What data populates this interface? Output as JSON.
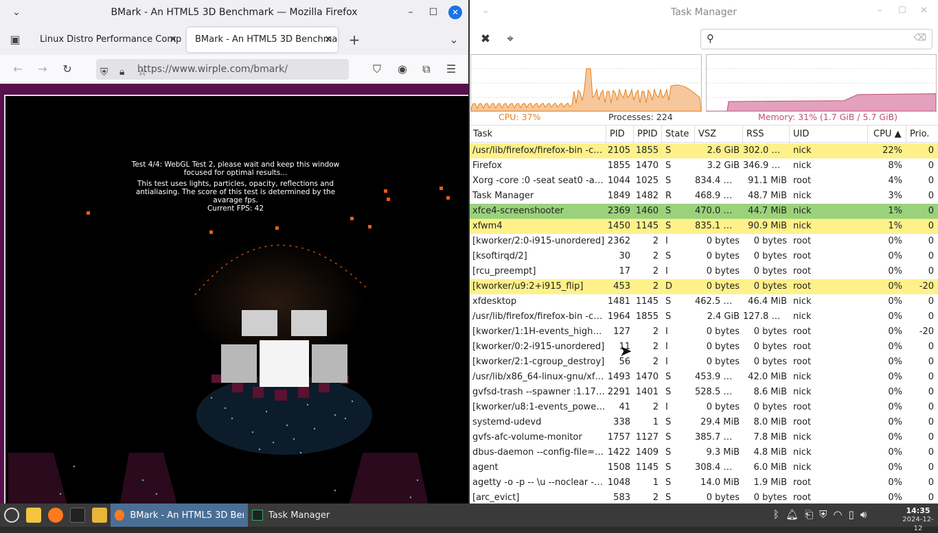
{
  "firefox": {
    "title": "BMark - An HTML5 3D Benchmark — Mozilla Firefox",
    "tabs": [
      {
        "label": "Linux Distro Performance Comp"
      },
      {
        "label": "BMark - An HTML5 3D Benchma"
      }
    ],
    "url": "https://www.wirple.com/bmark/",
    "bench": {
      "line1": "Test 4/4: WebGL Test 2, please wait and keep this window focused for optimal results...",
      "line2": "This test uses lights, particles, opacity, reflections and antialiasing. The score of this test is determined by the avarage fps.",
      "fps": "Current FPS: 42"
    }
  },
  "taskmanager": {
    "title": "Task Manager",
    "cpu_label": "CPU: 37%",
    "processes_label": "Processes: 224",
    "memory_label": "Memory: 31% (1.7 GiB / 5.7 GiB)",
    "cpu_percent": 37,
    "memory_percent": 31,
    "colors": {
      "cpu": "#e8821c",
      "memory": "#c14b7a",
      "highlight": "#fef18a",
      "green": "#9ad27c"
    },
    "columns": [
      "Task",
      "PID",
      "PPID",
      "State",
      "VSZ",
      "RSS",
      "UID",
      "CPU ▲",
      "Prio."
    ],
    "rows": [
      {
        "task": "/usr/lib/firefox/firefox-bin -co…",
        "pid": "2105",
        "ppid": "1855",
        "state": "S",
        "vsz": "2.6 GiB",
        "rss": "302.0 MiB",
        "uid": "nick",
        "cpu": "22%",
        "prio": "0",
        "hl": "yellow"
      },
      {
        "task": "Firefox",
        "pid": "1855",
        "ppid": "1470",
        "state": "S",
        "vsz": "3.2 GiB",
        "rss": "346.9 MiB",
        "uid": "nick",
        "cpu": "8%",
        "prio": "0",
        "hl": ""
      },
      {
        "task": "Xorg -core :0 -seat seat0 -aut…",
        "pid": "1044",
        "ppid": "1025",
        "state": "S",
        "vsz": "834.4 MiB",
        "rss": "91.1 MiB",
        "uid": "root",
        "cpu": "4%",
        "prio": "0",
        "hl": ""
      },
      {
        "task": "Task Manager",
        "pid": "1849",
        "ppid": "1482",
        "state": "R",
        "vsz": "468.9 MiB",
        "rss": "48.7 MiB",
        "uid": "nick",
        "cpu": "3%",
        "prio": "0",
        "hl": ""
      },
      {
        "task": "xfce4-screenshooter",
        "pid": "2369",
        "ppid": "1460",
        "state": "S",
        "vsz": "470.0 MiB",
        "rss": "44.7 MiB",
        "uid": "nick",
        "cpu": "1%",
        "prio": "0",
        "hl": "green"
      },
      {
        "task": "xfwm4",
        "pid": "1450",
        "ppid": "1145",
        "state": "S",
        "vsz": "835.1 MiB",
        "rss": "90.9 MiB",
        "uid": "nick",
        "cpu": "1%",
        "prio": "0",
        "hl": "yellow"
      },
      {
        "task": "[kworker/2:0-i915-unordered]",
        "pid": "2362",
        "ppid": "2",
        "state": "I",
        "vsz": "0 bytes",
        "rss": "0 bytes",
        "uid": "root",
        "cpu": "0%",
        "prio": "0",
        "hl": ""
      },
      {
        "task": "[ksoftirqd/2]",
        "pid": "30",
        "ppid": "2",
        "state": "S",
        "vsz": "0 bytes",
        "rss": "0 bytes",
        "uid": "root",
        "cpu": "0%",
        "prio": "0",
        "hl": ""
      },
      {
        "task": "[rcu_preempt]",
        "pid": "17",
        "ppid": "2",
        "state": "I",
        "vsz": "0 bytes",
        "rss": "0 bytes",
        "uid": "root",
        "cpu": "0%",
        "prio": "0",
        "hl": ""
      },
      {
        "task": "[kworker/u9:2+i915_flip]",
        "pid": "453",
        "ppid": "2",
        "state": "D",
        "vsz": "0 bytes",
        "rss": "0 bytes",
        "uid": "root",
        "cpu": "0%",
        "prio": "-20",
        "hl": "yellow"
      },
      {
        "task": "xfdesktop",
        "pid": "1481",
        "ppid": "1145",
        "state": "S",
        "vsz": "462.5 MiB",
        "rss": "46.4 MiB",
        "uid": "nick",
        "cpu": "0%",
        "prio": "0",
        "hl": ""
      },
      {
        "task": "/usr/lib/firefox/firefox-bin -co…",
        "pid": "1964",
        "ppid": "1855",
        "state": "S",
        "vsz": "2.4 GiB",
        "rss": "127.8 MiB",
        "uid": "nick",
        "cpu": "0%",
        "prio": "0",
        "hl": ""
      },
      {
        "task": "[kworker/1:1H-events_highpri]",
        "pid": "127",
        "ppid": "2",
        "state": "I",
        "vsz": "0 bytes",
        "rss": "0 bytes",
        "uid": "root",
        "cpu": "0%",
        "prio": "-20",
        "hl": ""
      },
      {
        "task": "[kworker/0:2-i915-unordered]",
        "pid": "11",
        "ppid": "2",
        "state": "I",
        "vsz": "0 bytes",
        "rss": "0 bytes",
        "uid": "root",
        "cpu": "0%",
        "prio": "0",
        "hl": ""
      },
      {
        "task": "[kworker/2:1-cgroup_destroy]",
        "pid": "56",
        "ppid": "2",
        "state": "I",
        "vsz": "0 bytes",
        "rss": "0 bytes",
        "uid": "root",
        "cpu": "0%",
        "prio": "0",
        "hl": ""
      },
      {
        "task": "/usr/lib/x86_64-linux-gnu/xf…",
        "pid": "1493",
        "ppid": "1470",
        "state": "S",
        "vsz": "453.9 MiB",
        "rss": "42.0 MiB",
        "uid": "nick",
        "cpu": "0%",
        "prio": "0",
        "hl": ""
      },
      {
        "task": "gvfsd-trash --spawner :1.17 /…",
        "pid": "2291",
        "ppid": "1401",
        "state": "S",
        "vsz": "528.5 MiB",
        "rss": "8.6 MiB",
        "uid": "nick",
        "cpu": "0%",
        "prio": "0",
        "hl": ""
      },
      {
        "task": "[kworker/u8:1-events_power…",
        "pid": "41",
        "ppid": "2",
        "state": "I",
        "vsz": "0 bytes",
        "rss": "0 bytes",
        "uid": "root",
        "cpu": "0%",
        "prio": "0",
        "hl": ""
      },
      {
        "task": "systemd-udevd",
        "pid": "338",
        "ppid": "1",
        "state": "S",
        "vsz": "29.4 MiB",
        "rss": "8.0 MiB",
        "uid": "root",
        "cpu": "0%",
        "prio": "0",
        "hl": ""
      },
      {
        "task": "gvfs-afc-volume-monitor",
        "pid": "1757",
        "ppid": "1127",
        "state": "S",
        "vsz": "385.7 MiB",
        "rss": "7.8 MiB",
        "uid": "nick",
        "cpu": "0%",
        "prio": "0",
        "hl": ""
      },
      {
        "task": "dbus-daemon --config-file=/u…",
        "pid": "1422",
        "ppid": "1409",
        "state": "S",
        "vsz": "9.3 MiB",
        "rss": "4.8 MiB",
        "uid": "nick",
        "cpu": "0%",
        "prio": "0",
        "hl": ""
      },
      {
        "task": "agent",
        "pid": "1508",
        "ppid": "1145",
        "state": "S",
        "vsz": "308.4 MiB",
        "rss": "6.0 MiB",
        "uid": "nick",
        "cpu": "0%",
        "prio": "0",
        "hl": ""
      },
      {
        "task": "agetty -o -p -- \\u --noclear - linux",
        "pid": "1048",
        "ppid": "1",
        "state": "S",
        "vsz": "14.0 MiB",
        "rss": "1.9 MiB",
        "uid": "root",
        "cpu": "0%",
        "prio": "0",
        "hl": ""
      },
      {
        "task": "[arc_evict]",
        "pid": "583",
        "ppid": "2",
        "state": "S",
        "vsz": "0 bytes",
        "rss": "0 bytes",
        "uid": "root",
        "cpu": "0%",
        "prio": "0",
        "hl": ""
      }
    ]
  },
  "taskbar": {
    "apps": [
      {
        "label": "BMark - An HTML5 3D Ben…"
      },
      {
        "label": "Task Manager"
      }
    ],
    "time": "14:35",
    "date": "2024-12-12"
  }
}
